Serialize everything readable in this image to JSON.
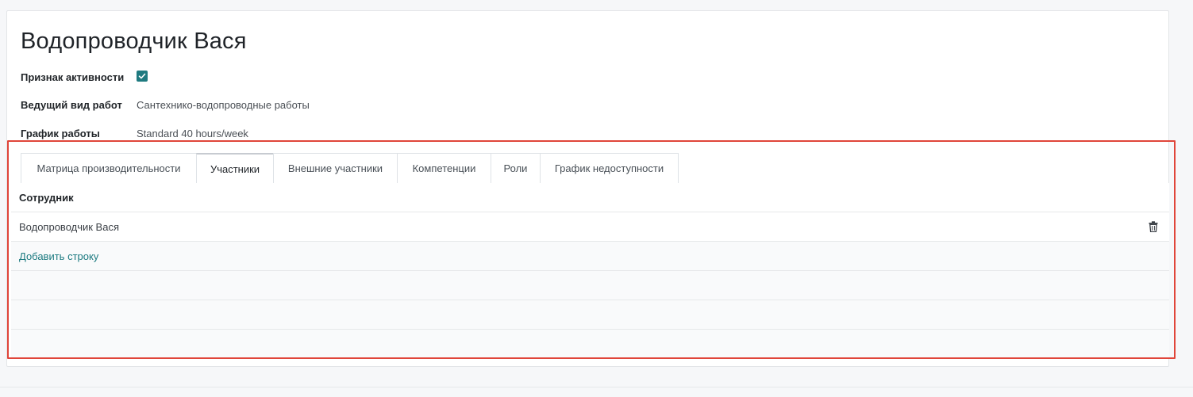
{
  "record": {
    "title": "Водопроводчик Вася",
    "fields": {
      "active_label": "Признак активности",
      "active_checked": true,
      "work_type_label": "Ведущий вид работ",
      "work_type_value": "Сантехнико-водопроводные работы",
      "schedule_label": "График работы",
      "schedule_value": "Standard 40 hours/week"
    }
  },
  "tabs": [
    {
      "label": "Матрица производительности",
      "active": false
    },
    {
      "label": "Участники",
      "active": true
    },
    {
      "label": "Внешние участники",
      "active": false
    },
    {
      "label": "Компетенции",
      "active": false
    },
    {
      "label": "Роли",
      "active": false
    },
    {
      "label": "График недоступности",
      "active": false
    }
  ],
  "table": {
    "header": "Сотрудник",
    "rows": [
      "Водопроводчик Вася"
    ],
    "add_label": "Добавить строку"
  },
  "colors": {
    "accent": "#1f7a80",
    "highlight": "#e0453a"
  },
  "icons": {
    "checkbox": "checkmark-icon",
    "delete": "trash-icon"
  }
}
